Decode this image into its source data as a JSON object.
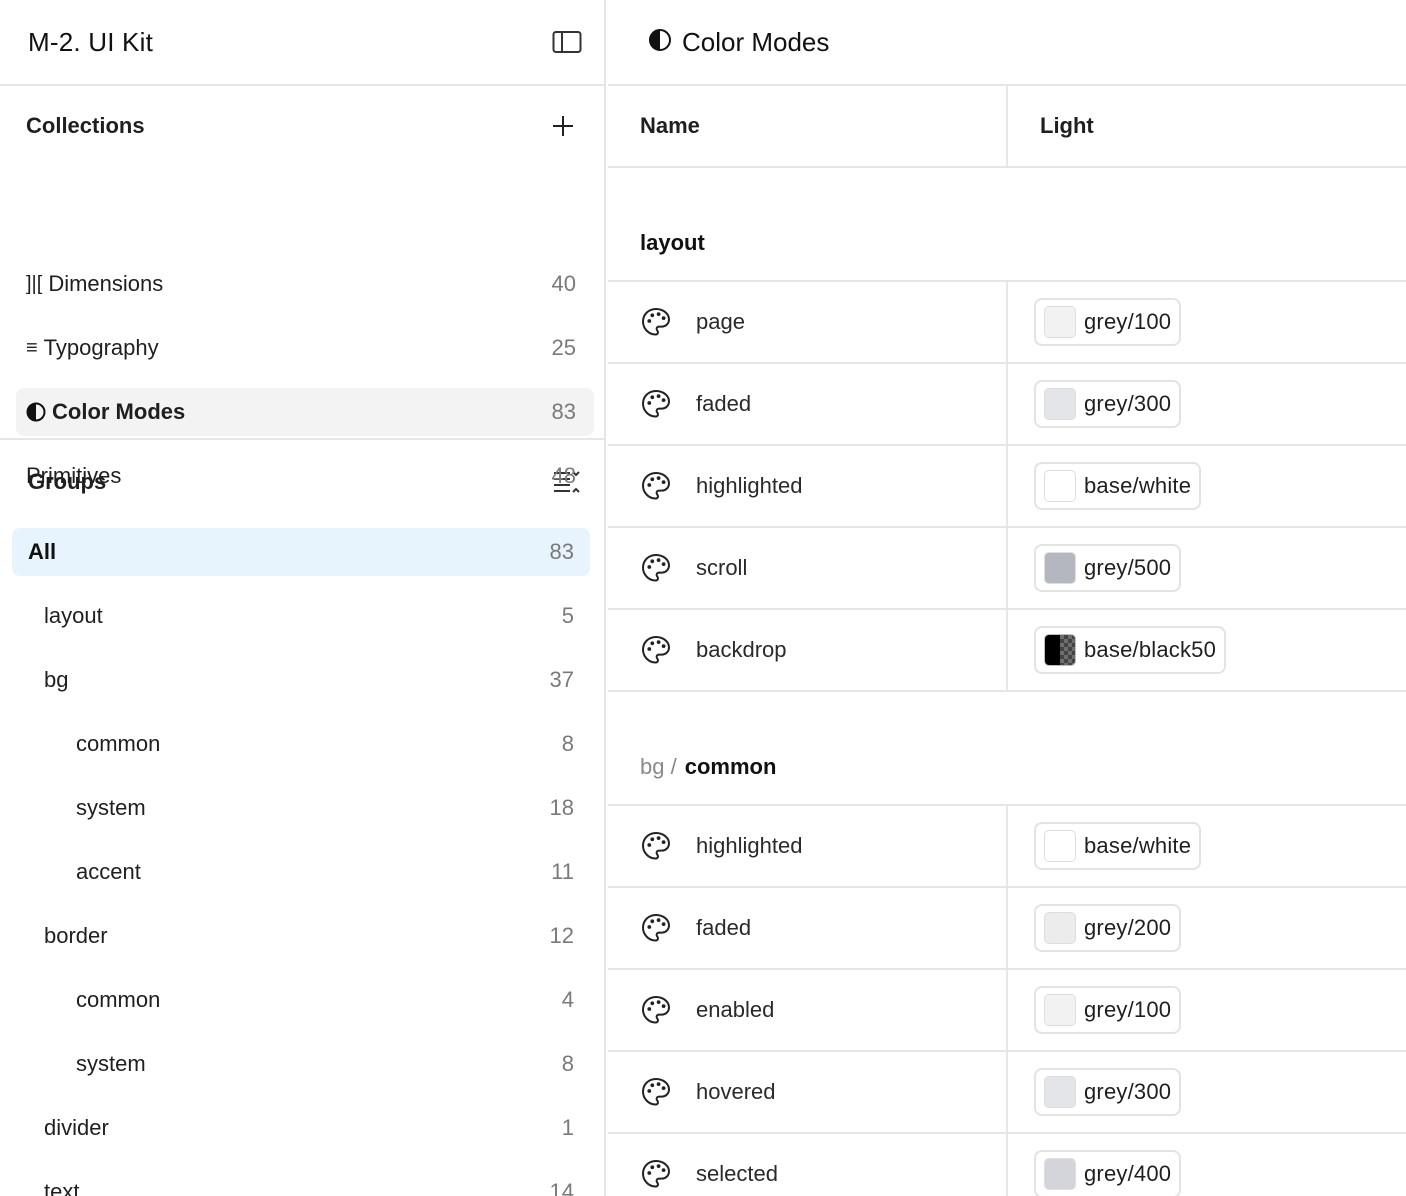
{
  "app": {
    "title": "M-2. UI Kit"
  },
  "collections": {
    "title": "Collections",
    "items": [
      {
        "icon": "]|[",
        "label": "Dimensions",
        "count": "40"
      },
      {
        "icon": "≡",
        "label": "Typography",
        "count": "25"
      },
      {
        "icon": "half-circle-icon",
        "label": "Color Modes",
        "count": "83",
        "active": true
      },
      {
        "icon": "",
        "label": "Primitives",
        "count": "48"
      }
    ]
  },
  "groups": {
    "title": "Groups",
    "items": [
      {
        "label": "All",
        "count": "83",
        "active": true
      },
      {
        "label": "layout",
        "count": "5"
      },
      {
        "label": "bg",
        "count": "37"
      },
      {
        "label": "common",
        "count": "8"
      },
      {
        "label": "system",
        "count": "18"
      },
      {
        "label": "accent",
        "count": "11"
      },
      {
        "label": "border",
        "count": "12"
      },
      {
        "label": "common",
        "count": "4"
      },
      {
        "label": "system",
        "count": "8"
      },
      {
        "label": "divider",
        "count": "1"
      },
      {
        "label": "text",
        "count": "14"
      }
    ]
  },
  "main": {
    "title": "Color Modes",
    "columns": {
      "name": "Name",
      "light": "Light"
    },
    "sections": [
      {
        "prefix": "",
        "name": "layout",
        "rows": [
          {
            "name": "page",
            "value": "grey/100",
            "swatch": "#f2f2f3"
          },
          {
            "name": "faded",
            "value": "grey/300",
            "swatch": "#e4e5e8"
          },
          {
            "name": "highlighted",
            "value": "base/white",
            "swatch": "#ffffff"
          },
          {
            "name": "scroll",
            "value": "grey/500",
            "swatch": "#b4b6c0"
          },
          {
            "name": "backdrop",
            "value": "base/black50",
            "swatch": "split-black-transparent"
          }
        ]
      },
      {
        "prefix": "bg /",
        "name": "common",
        "rows": [
          {
            "name": "highlighted",
            "value": "base/white",
            "swatch": "#ffffff"
          },
          {
            "name": "faded",
            "value": "grey/200",
            "swatch": "#ececed"
          },
          {
            "name": "enabled",
            "value": "grey/100",
            "swatch": "#f2f2f3"
          },
          {
            "name": "hovered",
            "value": "grey/300",
            "swatch": "#e4e5e8"
          },
          {
            "name": "selected",
            "value": "grey/400",
            "swatch": "#d4d5db"
          }
        ]
      }
    ]
  }
}
